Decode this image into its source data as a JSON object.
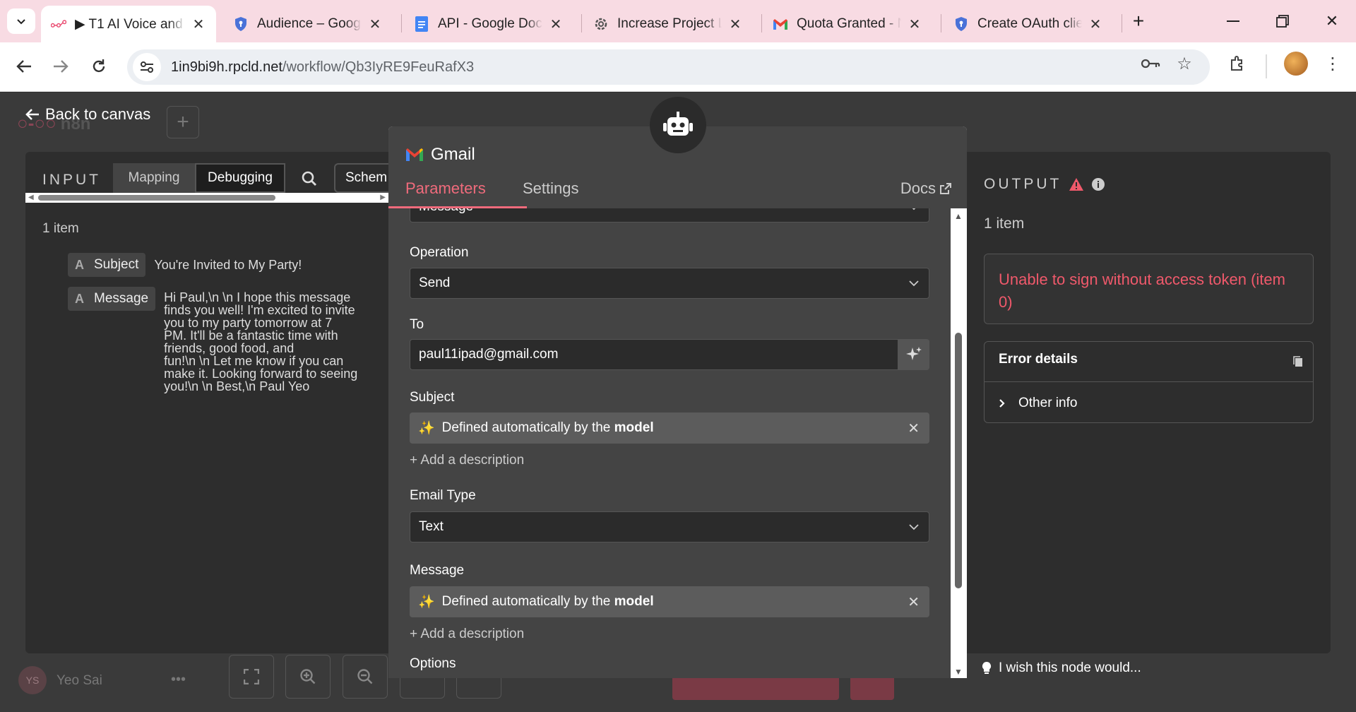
{
  "browser": {
    "tabs": [
      {
        "title": "▶ T1 AI Voice and",
        "active": true
      },
      {
        "title": "Audience – Google"
      },
      {
        "title": "API - Google Docs"
      },
      {
        "title": "Increase Project Lir"
      },
      {
        "title": "Quota Granted - N"
      },
      {
        "title": "Create OAuth clien"
      }
    ],
    "url_host": "1in9bi9h.rpcld.net",
    "url_path": "/workflow/Qb3IyRE9FeuRafX3"
  },
  "app": {
    "logo": "n8n",
    "back_label": "Back to canvas",
    "user_initials": "YS",
    "user_name": "Yeo Sai",
    "user_menu": "•••"
  },
  "input": {
    "title": "INPUT",
    "mode_mapping": "Mapping",
    "mode_debugging": "Debugging",
    "view_schema": "Schem",
    "items": "1 item",
    "fields": [
      {
        "type": "A",
        "name": "Subject",
        "value": "You're Invited to My Party!"
      },
      {
        "type": "A",
        "name": "Message"
      }
    ],
    "message_lines": [
      "Hi Paul,\\n \\n I hope this message",
      "finds you well! I'm excited to invite",
      "you to my party tomorrow at 7",
      "PM. It'll be a fantastic time with",
      "friends, good food, and",
      "fun!\\n \\n Let me know if you can",
      "make it. Looking forward to seeing",
      "you!\\n \\n Best,\\n Paul Yeo"
    ]
  },
  "node": {
    "title": "Gmail",
    "tab_parameters": "Parameters",
    "tab_settings": "Settings",
    "docs": "Docs",
    "resource_value": "Message",
    "operation_label": "Operation",
    "operation_value": "Send",
    "to_label": "To",
    "to_value": "paul11ipad@gmail.com",
    "subject_label": "Subject",
    "model_prefix": "Defined automatically by the ",
    "model_word": "model",
    "add_description": "+ Add a description",
    "email_type_label": "Email Type",
    "email_type_value": "Text",
    "message_label": "Message",
    "options_label": "Options"
  },
  "output": {
    "title": "OUTPUT",
    "items": "1 item",
    "error": "Unable to sign without access token (item 0)",
    "error_details": "Error details",
    "other_info": "Other info",
    "wish": "I wish this node would..."
  },
  "colors": {
    "accent": "#f06b7c",
    "error": "#f0596b",
    "panel": "#444444"
  }
}
